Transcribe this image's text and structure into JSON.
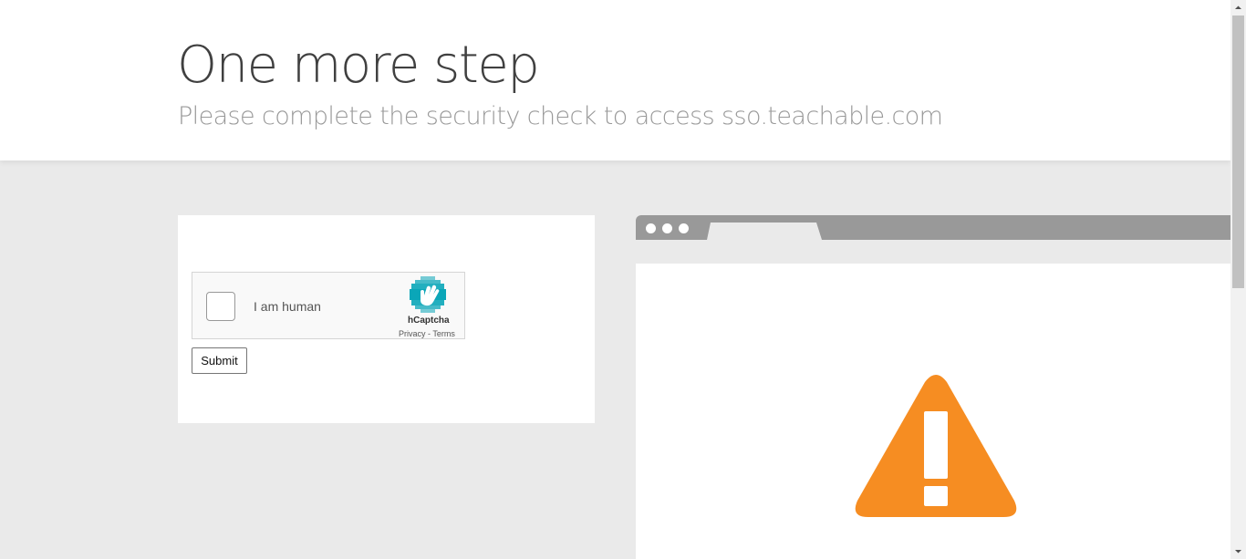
{
  "header": {
    "title": "One more step",
    "subtitle": "Please complete the security check to access sso.teachable.com"
  },
  "captcha": {
    "label": "I am human",
    "brand": "hCaptcha",
    "privacy_link": "Privacy",
    "separator": " - ",
    "terms_link": "Terms",
    "checked": false
  },
  "form": {
    "submit_label": "Submit"
  },
  "illustration": {
    "warning_color": "#f68d22",
    "browser_frame_color": "#999999",
    "icons": [
      "hcaptcha-logo-icon",
      "warning-icon"
    ]
  },
  "colors": {
    "background": "#eaeaea",
    "title": "#404040",
    "subtitle": "#999999",
    "hcaptcha_teal": "#0aa6b8"
  }
}
